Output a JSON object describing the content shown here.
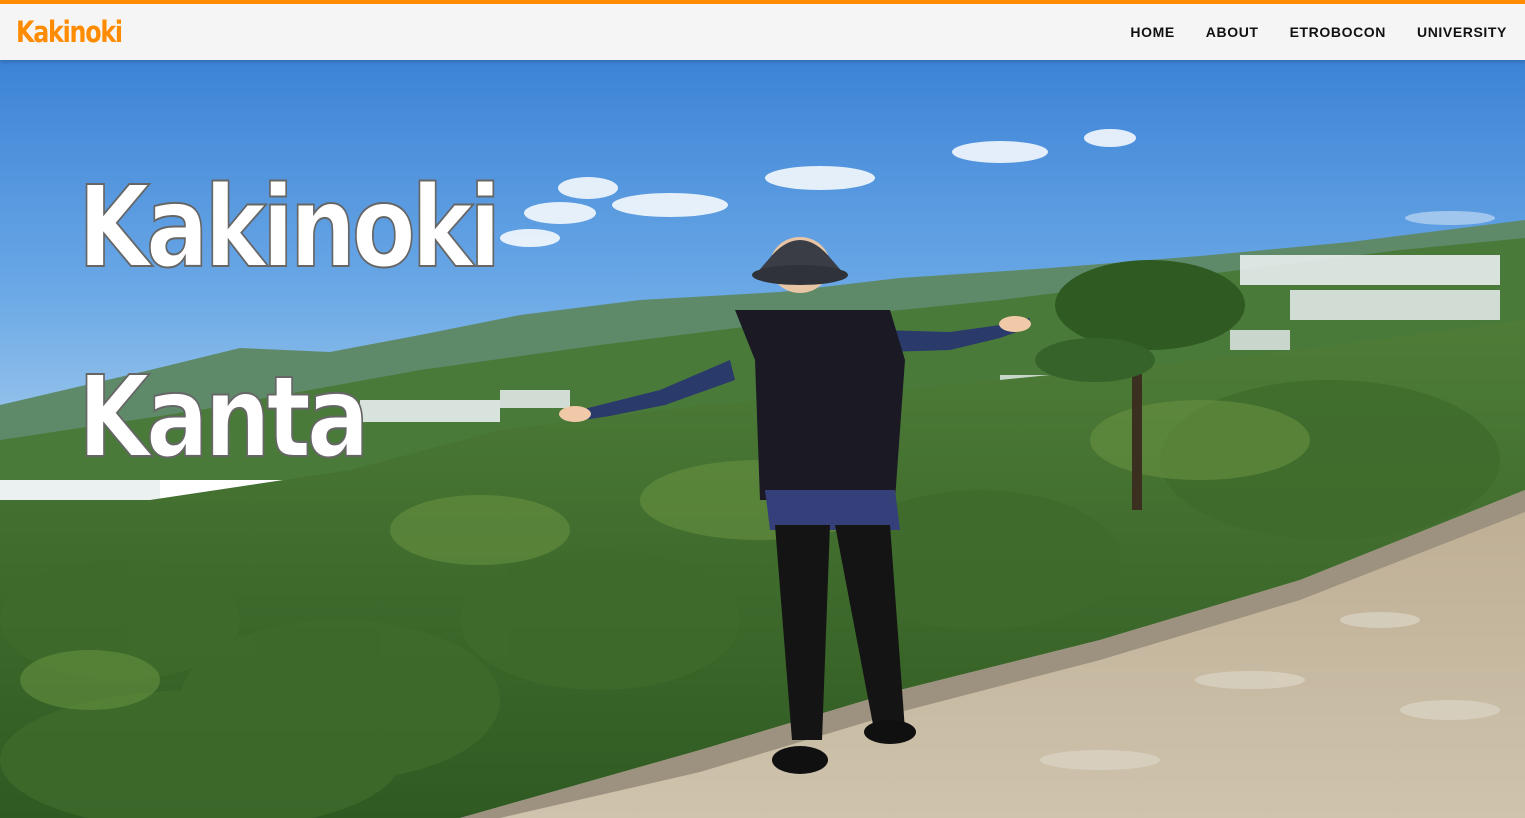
{
  "header": {
    "brand": "Kakinoki",
    "nav": [
      {
        "label": "HOME"
      },
      {
        "label": "ABOUT"
      },
      {
        "label": "ETROBOCON"
      },
      {
        "label": "UNIVERSITY"
      }
    ]
  },
  "hero": {
    "title_first": "Kakinoki",
    "title_last": "Kanta",
    "image": "person standing with outstretched arms on stone wall overlooking green forested valley under blue sky"
  },
  "colors": {
    "accent": "#ff8c00",
    "header_bg": "#f5f5f5",
    "nav_text": "#111111",
    "title_fill": "#ffffff"
  }
}
